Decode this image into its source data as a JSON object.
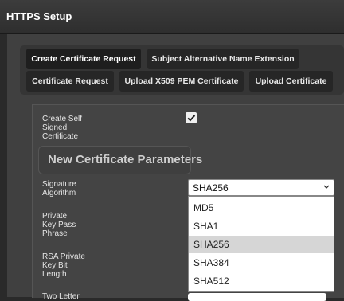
{
  "window": {
    "title": "HTTPS Setup"
  },
  "tabs": [
    {
      "label": "Create Certificate Request",
      "active": true
    },
    {
      "label": "Subject Alternative Name Extension",
      "active": false
    },
    {
      "label": "Certificate Request",
      "active": false
    },
    {
      "label": "Upload X509 PEM Certificate",
      "active": false
    },
    {
      "label": "Upload Certificate",
      "active": false
    }
  ],
  "form": {
    "self_signed": {
      "label": "Create Self Signed Certificate",
      "checked": true
    },
    "section_title": "New Certificate Parameters",
    "signature_algorithm": {
      "label": "Signature Algorithm",
      "value": "SHA256",
      "options": [
        "MD5",
        "SHA1",
        "SHA256",
        "SHA384",
        "SHA512"
      ]
    },
    "private_key_pass_phrase": {
      "label": "Private Key Pass Phrase"
    },
    "rsa_key_bit_length": {
      "label": "RSA Private Key Bit Length"
    },
    "two_letter": {
      "label": "Two Letter"
    }
  }
}
